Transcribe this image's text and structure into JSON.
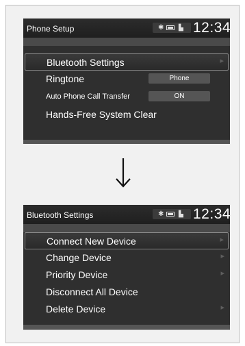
{
  "screens": [
    {
      "title": "Phone Setup",
      "clock": "12:34",
      "items": [
        {
          "label": "Bluetooth Settings",
          "value": "",
          "chevron": true,
          "selected": true
        },
        {
          "label": "Ringtone",
          "value": "Phone",
          "chevron": false,
          "selected": false
        },
        {
          "label": "Auto Phone Call Transfer",
          "value": "ON",
          "chevron": false,
          "selected": false
        },
        {
          "label": "Hands-Free System Clear",
          "value": "",
          "chevron": false,
          "selected": false
        }
      ]
    },
    {
      "title": "Bluetooth Settings",
      "clock": "12:34",
      "items": [
        {
          "label": "Connect New Device",
          "chevron": true,
          "selected": true
        },
        {
          "label": "Change Device",
          "chevron": true,
          "selected": false
        },
        {
          "label": "Priority Device",
          "chevron": true,
          "selected": false
        },
        {
          "label": "Disconnect All Device",
          "chevron": false,
          "selected": false
        },
        {
          "label": "Delete Device",
          "chevron": true,
          "selected": false
        }
      ]
    }
  ],
  "icons": {
    "bluetooth": "bluetooth-icon",
    "battery": "battery-icon",
    "signal": "signal-icon",
    "arrow": "down-arrow-icon",
    "chevron": "chevron-right-icon"
  },
  "colors": {
    "screen_bg": "#2f2f2f",
    "titlebar_bg": "#1f1f1f",
    "highlight_border": "#8a8a8a",
    "value_box": "#555555"
  }
}
